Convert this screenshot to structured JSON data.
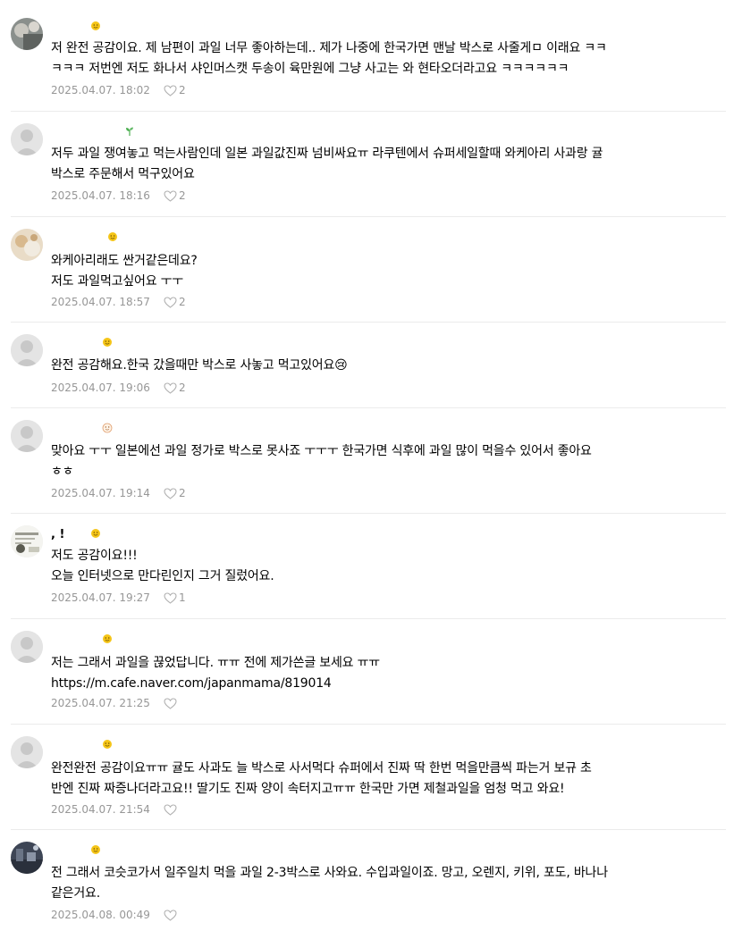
{
  "comments": [
    {
      "text": "저 완전 공감이요. 제 남편이 과일 너무 좋아하는데.. 제가 나중에 한국가면 맨날 박스로 사줄게ㅁ 이래요 ㅋㅋ\nㅋㅋㅋ 저번엔 저도 화나서 샤인머스캣 두송이 육만원에 그냥 사고는 와 현타오더라고요 ㅋㅋㅋㅋㅋㅋ",
      "date": "2025.04.07. 18:02",
      "likes": "2",
      "avatar": "photo-avatar",
      "badge": "smile-level-icon"
    },
    {
      "text": "저두 과일 쟁여놓고 먹는사람인데 일본 과일값진짜 넘비싸요ㅠ 라쿠텐에서 슈퍼세일할때 와케아리 사과랑 귤\n박스로 주문해서 먹구있어요",
      "date": "2025.04.07. 18:16",
      "likes": "2",
      "avatar": "default-avatar",
      "badge": "sprout-level-icon"
    },
    {
      "text": "와케아리래도 싼거같은데요?\n저도 과일먹고싶어요 ㅜㅜ",
      "date": "2025.04.07. 18:57",
      "likes": "2",
      "avatar": "photo-avatar",
      "badge": "smile-level-icon"
    },
    {
      "text": "완전 공감해요.한국 갔을때만 박스로 사놓고 먹고있어요😢",
      "date": "2025.04.07. 19:06",
      "likes": "2",
      "avatar": "default-avatar",
      "badge": "smile-level-icon"
    },
    {
      "text": "맞아요 ㅜㅜ 일본에선 과일 정가로 박스로 못사죠 ㅜㅜㅜ 한국가면 식후에 과일 많이 먹을수 있어서 좋아요\nㅎㅎ",
      "date": "2025.04.07. 19:14",
      "likes": "2",
      "avatar": "default-avatar",
      "badge": "face-level-icon"
    },
    {
      "nick": ",    !",
      "text": "저도 공감이요!!!\n오늘 인터넷으로 만다린인지 그거 질렀어요.",
      "date": "2025.04.07. 19:27",
      "likes": "1",
      "avatar": "photo-avatar",
      "badge": "smile-level-icon"
    },
    {
      "text": "저는 그래서 과일을 끊었답니다. ㅠㅠ 전에 제가쓴글 보세요 ㅠㅠ\nhttps://m.cafe.naver.com/japanmama/819014",
      "date": "2025.04.07. 21:25",
      "likes": "",
      "avatar": "default-avatar",
      "badge": "smile-level-icon"
    },
    {
      "text": "완전완전 공감이요ㅠㅠ 귤도 사과도 늘 박스로 사서먹다 슈퍼에서 진짜 딱 한번 먹을만큼씩 파는거 보규 초\n반엔 진짜 짜증나더라고요!! 딸기도 진짜 양이 속터지고ㅠㅠ 한국만 가면 제철과일을 엄청 먹고 와요!",
      "date": "2025.04.07. 21:54",
      "likes": "",
      "avatar": "default-avatar",
      "badge": "smile-level-icon"
    },
    {
      "text": "전 그래서 코슷코가서 일주일치 먹을 과일 2-3박스로 사와요. 수입과일이죠. 망고, 오렌지, 키위, 포도, 바나나\n같은거요.",
      "date": "2025.04.08. 00:49",
      "likes": "",
      "avatar": "photo-avatar",
      "badge": "smile-level-icon"
    }
  ],
  "colors": {
    "meta": "#979797",
    "divider": "#ebebeb",
    "badge": "#f5c518"
  }
}
